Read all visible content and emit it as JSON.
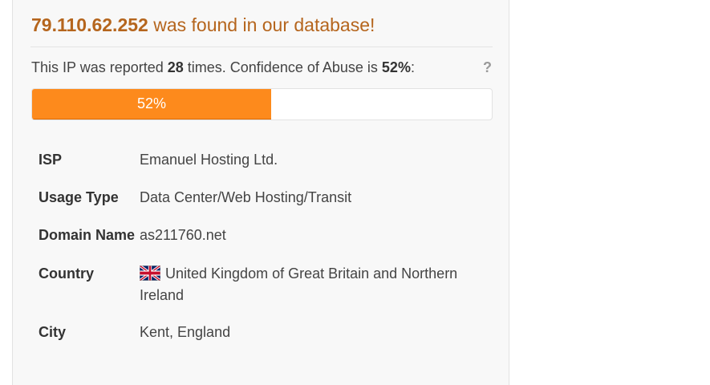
{
  "result": {
    "ip": "79.110.62.252",
    "headline_suffix": " was found in our database!"
  },
  "report": {
    "prefix": "This IP was reported ",
    "count": "28",
    "middle": " times. Confidence of Abuse is ",
    "confidence": "52%",
    "suffix": ":",
    "help_label": "?"
  },
  "progress": {
    "value": 52,
    "label": "52%",
    "fill_color": "#fd8a1c",
    "border_color": "#d96a06"
  },
  "details": {
    "isp": {
      "label": "ISP",
      "value": "Emanuel Hosting Ltd."
    },
    "usage_type": {
      "label": "Usage Type",
      "value": "Data Center/Web Hosting/Transit"
    },
    "domain_name": {
      "label": "Domain Name",
      "value": "as211760.net"
    },
    "country": {
      "label": "Country",
      "value": "United Kingdom of Great Britain and Northern Ireland",
      "flag_icon": "uk-flag-icon"
    },
    "city": {
      "label": "City",
      "value": "Kent, England"
    }
  },
  "colors": {
    "headline": "#b5651d",
    "panel_background": "#f8f8f8"
  }
}
